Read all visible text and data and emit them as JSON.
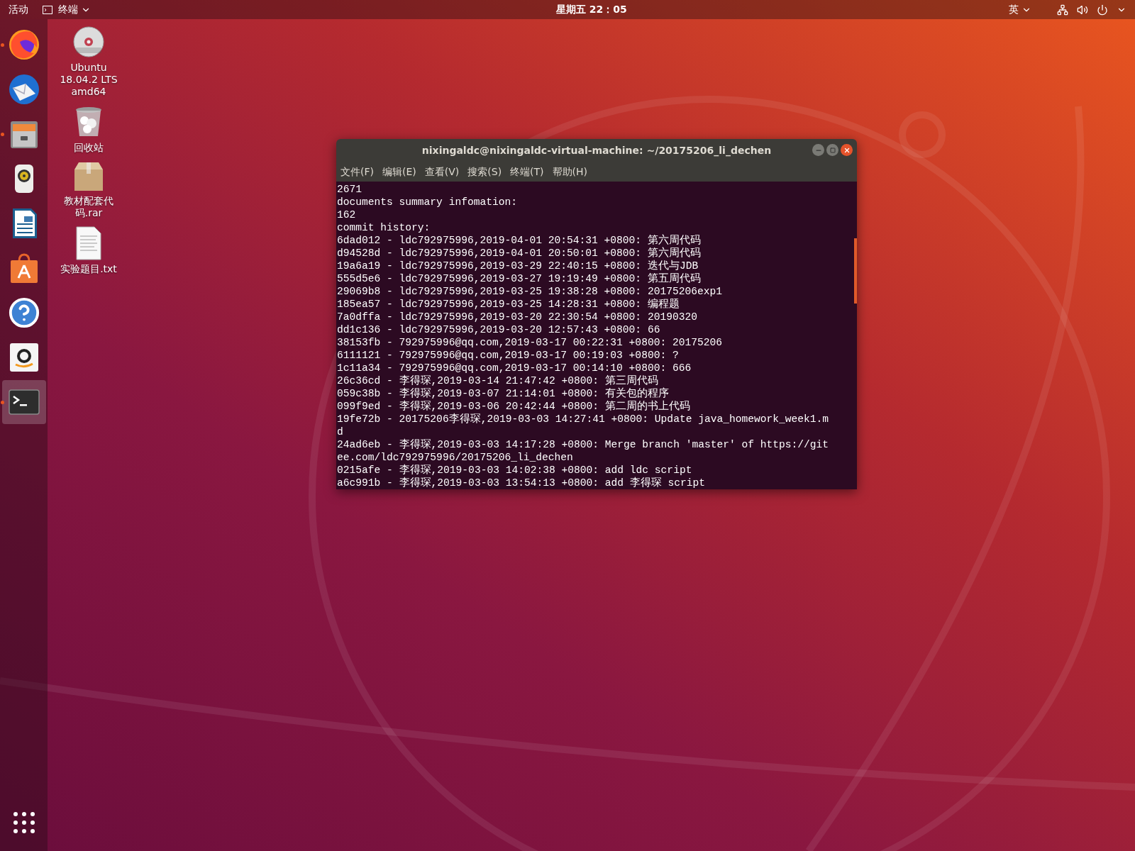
{
  "top_bar": {
    "activities": "活动",
    "app_menu": "终端",
    "clock": "星期五 22：05",
    "input_method": "英"
  },
  "dock": {
    "items": [
      {
        "kind": "firefox",
        "running": true,
        "selected": false
      },
      {
        "kind": "mail",
        "running": false,
        "selected": false
      },
      {
        "kind": "files",
        "running": true,
        "selected": false
      },
      {
        "kind": "music",
        "running": false,
        "selected": false
      },
      {
        "kind": "writer",
        "running": false,
        "selected": false
      },
      {
        "kind": "software",
        "running": false,
        "selected": false
      },
      {
        "kind": "help",
        "running": false,
        "selected": false
      },
      {
        "kind": "shop",
        "running": false,
        "selected": false
      },
      {
        "kind": "terminal",
        "running": true,
        "selected": true
      }
    ]
  },
  "desktop_icons": [
    {
      "kind": "disc",
      "label": "Ubuntu 18.04.2 LTS amd64"
    },
    {
      "kind": "trash",
      "label": "回收站"
    },
    {
      "kind": "archive",
      "label": "教材配套代码.rar"
    },
    {
      "kind": "text-file",
      "label": "实验题目.txt"
    }
  ],
  "terminal": {
    "title": "nixingaldc@nixingaldc-virtual-machine: ~/20175206_li_dechen",
    "menu": [
      "文件(F)",
      "编辑(E)",
      "查看(V)",
      "搜索(S)",
      "终端(T)",
      "帮助(H)"
    ],
    "lines": [
      "2671",
      "documents summary infomation:",
      "162",
      "commit history:",
      "6dad012 - ldc792975996,2019-04-01 20:54:31 +0800: 第六周代码",
      "d94528d - ldc792975996,2019-04-01 20:50:01 +0800: 第六周代码",
      "19a6a19 - ldc792975996,2019-03-29 22:40:15 +0800: 迭代与JDB",
      "555d5e6 - ldc792975996,2019-03-27 19:19:49 +0800: 第五周代码",
      "29069b8 - ldc792975996,2019-03-25 19:38:28 +0800: 20175206exp1",
      "185ea57 - ldc792975996,2019-03-25 14:28:31 +0800: 编程题",
      "7a0dffa - ldc792975996,2019-03-20 22:30:54 +0800: 20190320",
      "dd1c136 - ldc792975996,2019-03-20 12:57:43 +0800: 66",
      "38153fb - 792975996@qq.com,2019-03-17 00:22:31 +0800: 20175206",
      "6111121 - 792975996@qq.com,2019-03-17 00:19:03 +0800: ?",
      "1c11a34 - 792975996@qq.com,2019-03-17 00:14:10 +0800: 666",
      "26c36cd - 李得琛,2019-03-14 21:47:42 +0800: 第三周代码",
      "059c38b - 李得琛,2019-03-07 21:14:01 +0800: 有关包的程序",
      "099f9ed - 李得琛,2019-03-06 20:42:44 +0800: 第二周的书上代码",
      "19fe72b - 20175206李得琛,2019-03-03 14:27:41 +0800: Update java_homework_week1.m",
      "d",
      "24ad6eb - 李得琛,2019-03-03 14:17:28 +0800: Merge branch 'master' of https://git",
      "ee.com/ldc792975996/20175206_li_dechen",
      "0215afe - 李得琛,2019-03-03 14:02:38 +0800: add ldc script",
      "a6c991b - 李得琛,2019-03-03 13:54:13 +0800: add 李得琛 script"
    ]
  }
}
